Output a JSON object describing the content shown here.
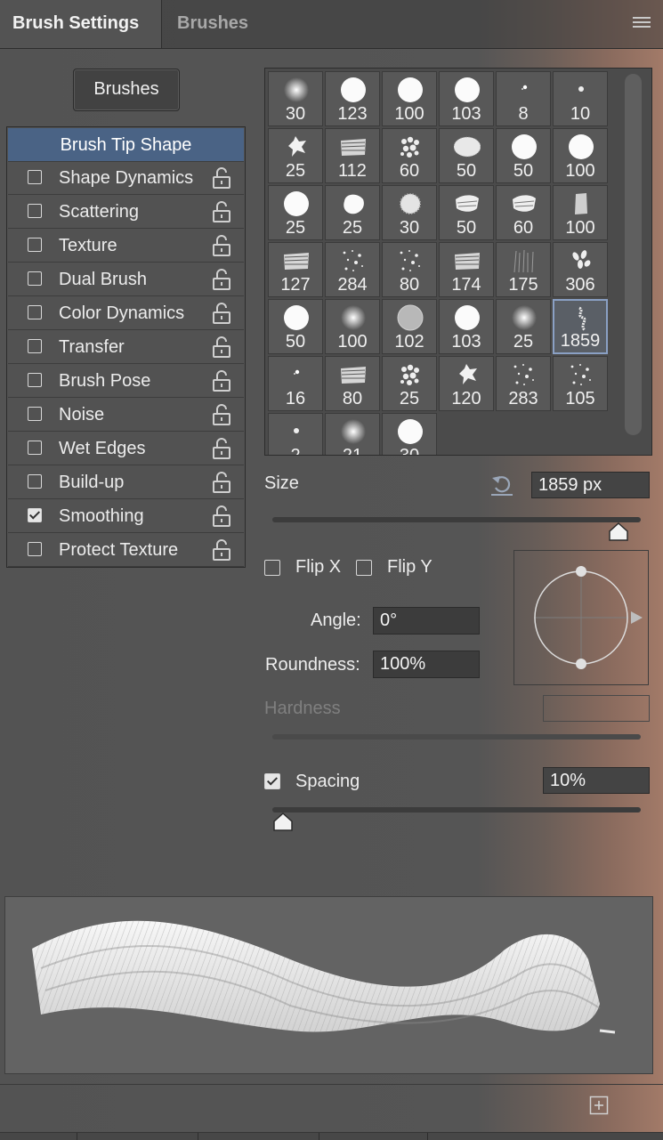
{
  "tabs": {
    "active": "Brush Settings",
    "inactive": "Brushes"
  },
  "brushes_button": "Brushes",
  "options": {
    "brush_tip_shape": "Brush Tip Shape",
    "items": [
      {
        "label": "Shape Dynamics",
        "checked": false
      },
      {
        "label": "Scattering",
        "checked": false
      },
      {
        "label": "Texture",
        "checked": false
      },
      {
        "label": "Dual Brush",
        "checked": false
      },
      {
        "label": "Color Dynamics",
        "checked": false
      },
      {
        "label": "Transfer",
        "checked": false
      },
      {
        "label": "Brush Pose",
        "checked": false
      },
      {
        "label": "Noise",
        "checked": false
      },
      {
        "label": "Wet Edges",
        "checked": false
      },
      {
        "label": "Build-up",
        "checked": false
      },
      {
        "label": "Smoothing",
        "checked": true
      },
      {
        "label": "Protect Texture",
        "checked": false
      }
    ]
  },
  "presets": [
    {
      "size": "30",
      "icon": "soft-round"
    },
    {
      "size": "123",
      "icon": "hard-round"
    },
    {
      "size": "100",
      "icon": "hard-round"
    },
    {
      "size": "103",
      "icon": "hard-round"
    },
    {
      "size": "8",
      "icon": "speck"
    },
    {
      "size": "10",
      "icon": "dot"
    },
    {
      "size": "25",
      "icon": "splat"
    },
    {
      "size": "112",
      "icon": "chalk"
    },
    {
      "size": "60",
      "icon": "sponge"
    },
    {
      "size": "50",
      "icon": "oval-texture"
    },
    {
      "size": "50",
      "icon": "hard-round"
    },
    {
      "size": "100",
      "icon": "hard-round"
    },
    {
      "size": "25",
      "icon": "hard-round"
    },
    {
      "size": "25",
      "icon": "blob"
    },
    {
      "size": "30",
      "icon": "fuzzy"
    },
    {
      "size": "50",
      "icon": "dry"
    },
    {
      "size": "60",
      "icon": "dry"
    },
    {
      "size": "100",
      "icon": "stamp"
    },
    {
      "size": "127",
      "icon": "chalk"
    },
    {
      "size": "284",
      "icon": "spatter"
    },
    {
      "size": "80",
      "icon": "spatter"
    },
    {
      "size": "174",
      "icon": "chalk"
    },
    {
      "size": "175",
      "icon": "grass"
    },
    {
      "size": "306",
      "icon": "leaves"
    },
    {
      "size": "50",
      "icon": "hard-round"
    },
    {
      "size": "100",
      "icon": "soft-round"
    },
    {
      "size": "102",
      "icon": "grey-round"
    },
    {
      "size": "103",
      "icon": "hard-round"
    },
    {
      "size": "25",
      "icon": "soft-round"
    },
    {
      "size": "1859",
      "icon": "custom-stroke"
    },
    {
      "size": "16",
      "icon": "speck"
    },
    {
      "size": "80",
      "icon": "chalk"
    },
    {
      "size": "25",
      "icon": "sponge"
    },
    {
      "size": "120",
      "icon": "splat"
    },
    {
      "size": "283",
      "icon": "spatter"
    },
    {
      "size": "105",
      "icon": "spatter"
    },
    {
      "size": "2",
      "icon": "dot"
    },
    {
      "size": "21",
      "icon": "soft-round"
    },
    {
      "size": "30",
      "icon": "hard-round"
    }
  ],
  "selected_preset": 29,
  "size": {
    "label": "Size",
    "value": "1859 px",
    "level": 0.94
  },
  "flip": {
    "x_label": "Flip X",
    "y_label": "Flip Y",
    "x_checked": false,
    "y_checked": false
  },
  "angle": {
    "label": "Angle:",
    "value": "0°"
  },
  "roundness": {
    "label": "Roundness:",
    "value": "100%"
  },
  "hardness": {
    "label": "Hardness",
    "value": ""
  },
  "spacing": {
    "label": "Spacing",
    "value": "10%",
    "checked": true,
    "level": 0.03
  }
}
